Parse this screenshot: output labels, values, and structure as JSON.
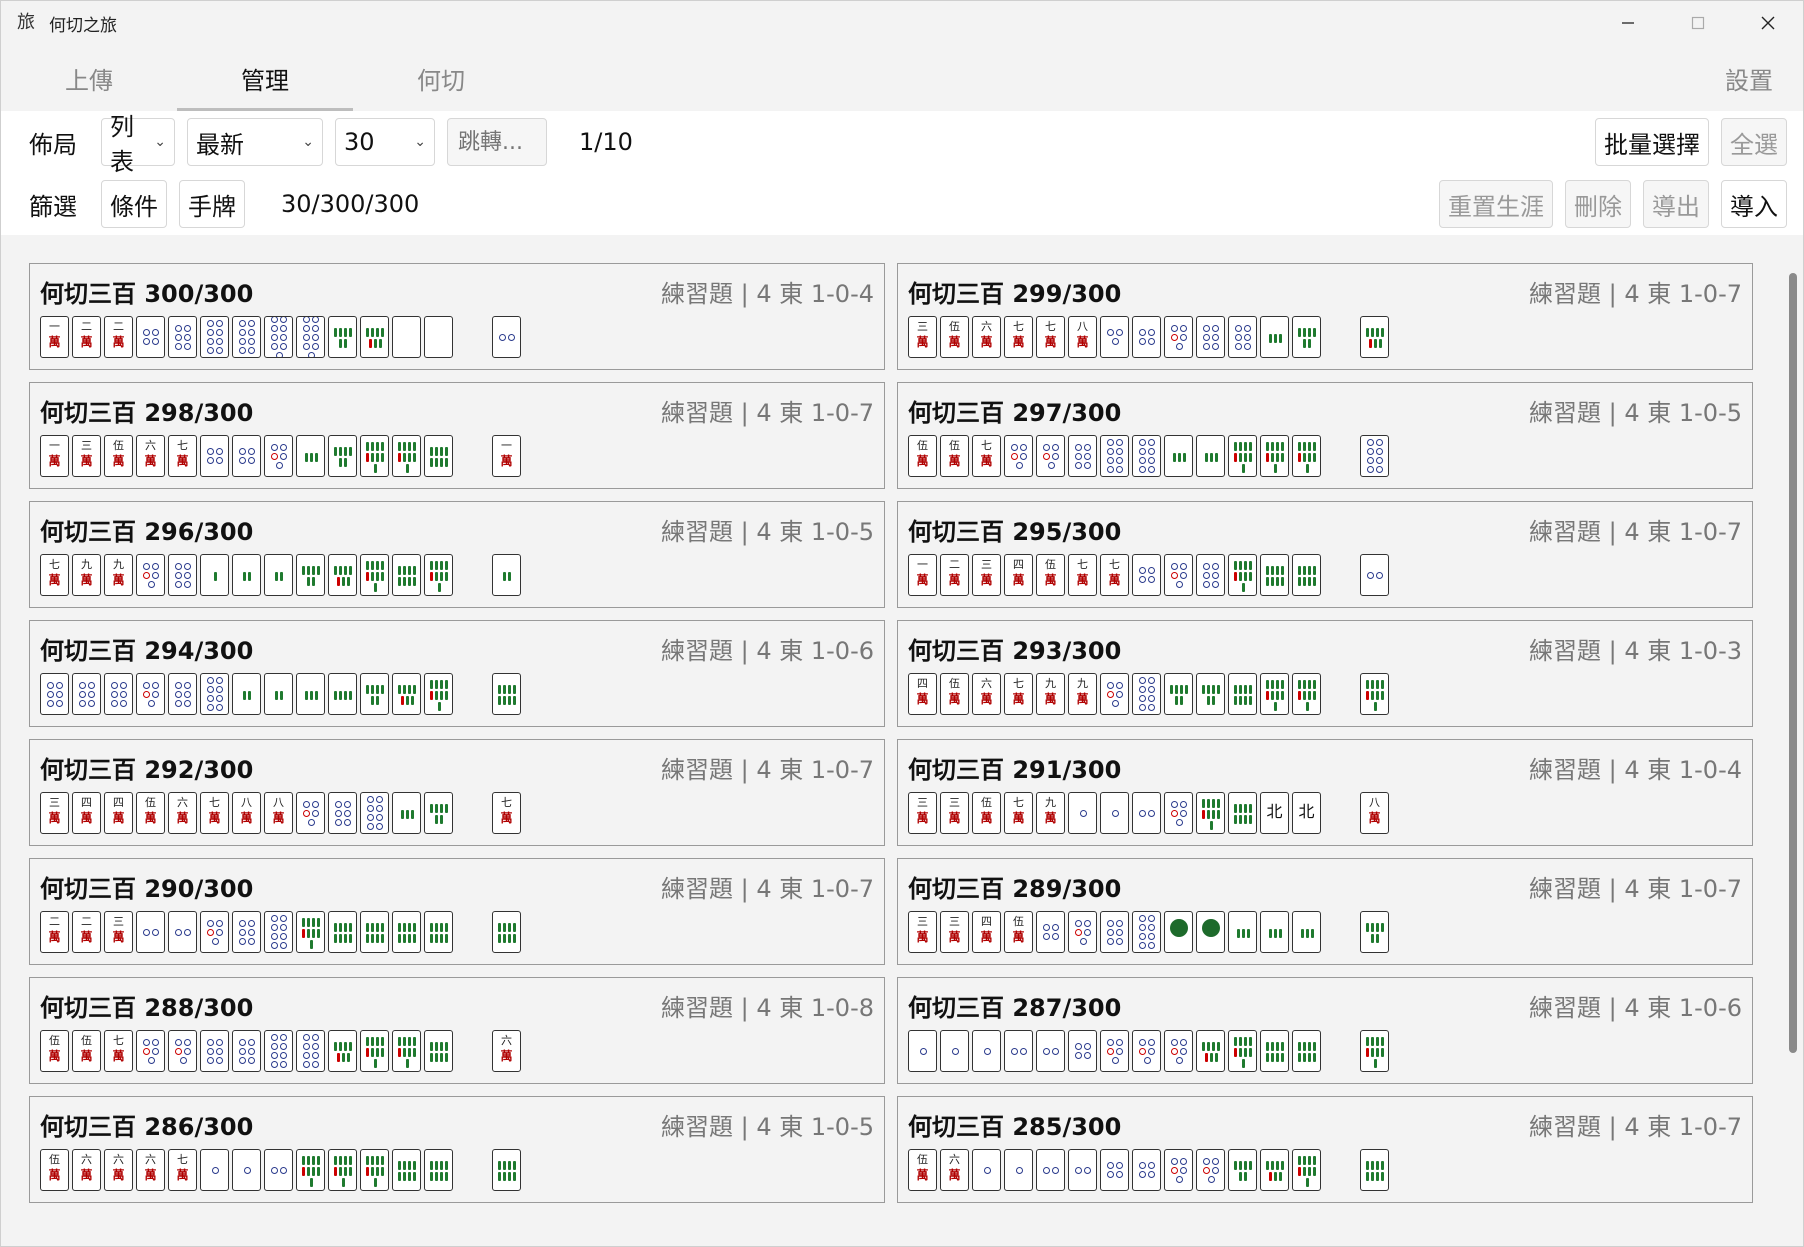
{
  "window": {
    "title": "何切之旅",
    "icon": "旅"
  },
  "tabs": [
    {
      "label": "上傳",
      "active": false
    },
    {
      "label": "管理",
      "active": true
    },
    {
      "label": "何切",
      "active": false
    }
  ],
  "settings_label": "設置",
  "toolbar": {
    "layout_label": "佈局",
    "layout_value": "列表",
    "sort_value": "最新",
    "page_size_value": "30",
    "jump_placeholder": "跳轉...",
    "page_info": "1/10",
    "batch_select_label": "批量選擇",
    "select_all_label": "全選",
    "filter_label": "篩選",
    "condition_label": "條件",
    "hand_label": "手牌",
    "count_text": "30/300/300",
    "reset_career_label": "重置生涯",
    "delete_label": "刪除",
    "export_label": "導出",
    "import_label": "導入"
  },
  "cards": [
    {
      "title": "何切三百 300/300",
      "meta": "練習題 | 4 東 1-0-4",
      "tiles": [
        "m1",
        "m2",
        "m2",
        "p4",
        "p6",
        "p8",
        "p8",
        "p9",
        "p9",
        "s6",
        "s7",
        "x",
        "x"
      ],
      "draw": "p2"
    },
    {
      "title": "何切三百 299/300",
      "meta": "練習題 | 4 東 1-0-7",
      "tiles": [
        "m3",
        "m5",
        "m6",
        "m7",
        "m7",
        "m8",
        "p3",
        "p4",
        "p5",
        "p6",
        "p6",
        "s3",
        "s6"
      ],
      "draw": "s7"
    },
    {
      "title": "何切三百 298/300",
      "meta": "練習題 | 4 東 1-0-7",
      "tiles": [
        "m1",
        "m3",
        "m5",
        "m6",
        "m7",
        "p4",
        "p4",
        "p5",
        "s3",
        "s6",
        "s9",
        "s9",
        "s8"
      ],
      "draw": "m1"
    },
    {
      "title": "何切三百 297/300",
      "meta": "練習題 | 4 東 1-0-5",
      "tiles": [
        "m5",
        "m5",
        "m7",
        "p5",
        "p5",
        "p6",
        "p8",
        "p8",
        "s3",
        "s3",
        "s9",
        "s9",
        "s9"
      ],
      "draw": "p8"
    },
    {
      "title": "何切三百 296/300",
      "meta": "練習題 | 4 東 1-0-5",
      "tiles": [
        "m7",
        "m9",
        "m9",
        "p5",
        "p6",
        "s1",
        "s2",
        "s2",
        "s6",
        "s7",
        "s9",
        "s8",
        "s9"
      ],
      "draw": "s2"
    },
    {
      "title": "何切三百 295/300",
      "meta": "練習題 | 4 東 1-0-7",
      "tiles": [
        "m1",
        "m2",
        "m3",
        "m4",
        "m5",
        "m7",
        "m7",
        "p4",
        "p5",
        "p6",
        "s9",
        "s8",
        "s8"
      ],
      "draw": "p2"
    },
    {
      "title": "何切三百 294/300",
      "meta": "練習題 | 4 東 1-0-6",
      "tiles": [
        "p6",
        "p6",
        "p6",
        "p5",
        "p6",
        "p8",
        "s2",
        "s2",
        "s3",
        "s4",
        "s6",
        "s7",
        "s9"
      ],
      "draw": "s8"
    },
    {
      "title": "何切三百 293/300",
      "meta": "練習題 | 4 東 1-0-3",
      "tiles": [
        "m4",
        "m5",
        "m6",
        "m7",
        "m9",
        "m9",
        "p5",
        "p8",
        "s6",
        "s6",
        "s8",
        "s9",
        "s9"
      ],
      "draw": "s9"
    },
    {
      "title": "何切三百 292/300",
      "meta": "練習題 | 4 東 1-0-7",
      "tiles": [
        "m3",
        "m4",
        "m4",
        "m5",
        "m6",
        "m7",
        "m8",
        "m8",
        "p5",
        "p6",
        "p8",
        "s3",
        "s6"
      ],
      "draw": "m7"
    },
    {
      "title": "何切三百 291/300",
      "meta": "練習題 | 4 東 1-0-4",
      "tiles": [
        "m3",
        "m3",
        "m5",
        "m7",
        "m9",
        "p1",
        "p1",
        "p2",
        "p5",
        "s9",
        "s8",
        "N",
        "N"
      ],
      "draw": "m8"
    },
    {
      "title": "何切三百 290/300",
      "meta": "練習題 | 4 東 1-0-7",
      "tiles": [
        "m2",
        "m2",
        "m3",
        "p2",
        "p2",
        "p5",
        "p6",
        "p8",
        "s9",
        "s8",
        "s8",
        "s8",
        "s8"
      ],
      "draw": "s8"
    },
    {
      "title": "何切三百 289/300",
      "meta": "練習題 | 4 東 1-0-7",
      "tiles": [
        "m3",
        "m3",
        "m4",
        "m5",
        "p4",
        "p5",
        "p6",
        "p8",
        "f",
        "f",
        "s3",
        "s3",
        "s3"
      ],
      "draw": "s6"
    },
    {
      "title": "何切三百 288/300",
      "meta": "練習題 | 4 東 1-0-8",
      "tiles": [
        "m5",
        "m5",
        "m7",
        "p5",
        "p5",
        "p6",
        "p6",
        "p8",
        "p8",
        "s7",
        "s9",
        "s9",
        "s8"
      ],
      "draw": "m6"
    },
    {
      "title": "何切三百 287/300",
      "meta": "練習題 | 4 東 1-0-6",
      "tiles": [
        "p1",
        "p1",
        "p1",
        "p2",
        "p2",
        "p4",
        "p5",
        "p5",
        "p5",
        "s7",
        "s9",
        "s8",
        "s8"
      ],
      "draw": "s9"
    },
    {
      "title": "何切三百 286/300",
      "meta": "練習題 | 4 東 1-0-5",
      "tiles": [
        "m5",
        "m6",
        "m6",
        "m6",
        "m7",
        "p1",
        "p1",
        "p2",
        "s9",
        "s9",
        "s9",
        "s8",
        "s8"
      ],
      "draw": "s8"
    },
    {
      "title": "何切三百 285/300",
      "meta": "練習題 | 4 東 1-0-7",
      "tiles": [
        "m5",
        "m6",
        "p1",
        "p1",
        "p2",
        "p2",
        "p4",
        "p4",
        "p5",
        "p5",
        "s6",
        "s7",
        "s9"
      ],
      "draw": "s8"
    }
  ],
  "colors": {
    "accent_tab": "#bdbdbd",
    "man_red": "#b00000",
    "pin_blue": "#2a3a8c",
    "sou_green": "#1f7a2f"
  }
}
